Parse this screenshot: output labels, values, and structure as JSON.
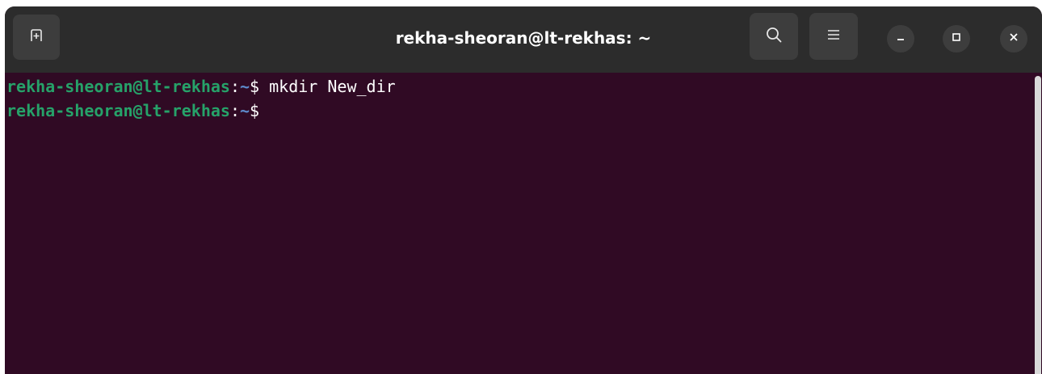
{
  "window": {
    "title": "rekha-sheoran@lt-rekhas: ~"
  },
  "titlebar": {
    "new_tab_icon": "new-tab-icon",
    "search_icon": "search-icon",
    "menu_icon": "hamburger-menu-icon",
    "minimize_icon": "minimize-icon",
    "maximize_icon": "maximize-icon",
    "close_icon": "close-icon",
    "minimize_glyph": "–",
    "close_glyph": "×"
  },
  "terminal": {
    "lines": [
      {
        "user_host": "rekha-sheoran@lt-rekhas",
        "colon": ":",
        "path": "~",
        "prompt_symbol": "$",
        "command": " mkdir New_dir"
      },
      {
        "user_host": "rekha-sheoran@lt-rekhas",
        "colon": ":",
        "path": "~",
        "prompt_symbol": "$",
        "command": ""
      }
    ]
  },
  "colors": {
    "terminal_bg": "#300a24",
    "titlebar_bg": "#2c2c2c",
    "prompt_user_host": "#26a269",
    "prompt_path": "#5d8acb",
    "text": "#ffffff"
  }
}
